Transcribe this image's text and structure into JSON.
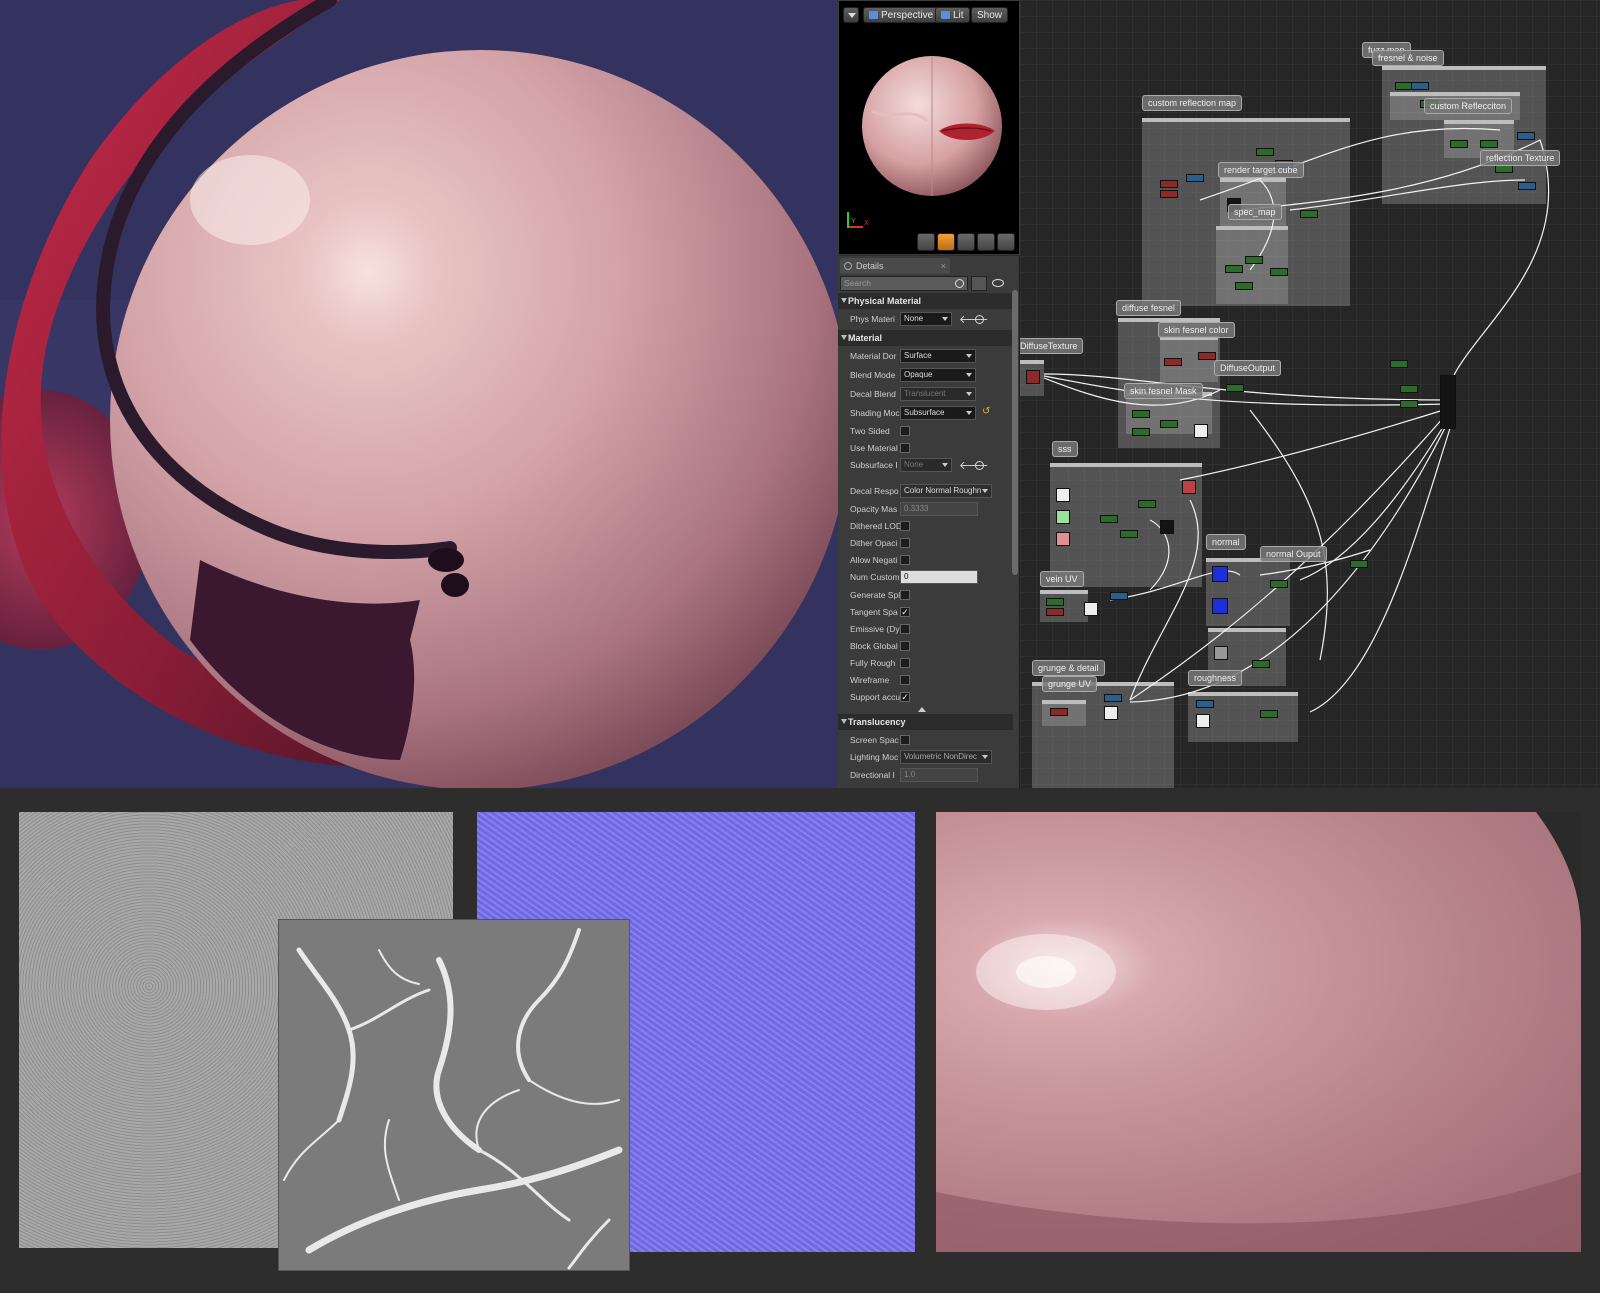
{
  "viewport": {
    "menu_label": "",
    "perspective_label": "Perspective",
    "lit_label": "Lit",
    "show_label": "Show",
    "axis_x": "X",
    "axis_y": "Y"
  },
  "details": {
    "tab_label": "Details",
    "tab_close": "×",
    "search_placeholder": "Search",
    "sections": {
      "physical_material": "Physical Material",
      "material": "Material",
      "translucency": "Translucency"
    },
    "properties": {
      "phys_material": {
        "label": "Phys Materi",
        "value": "None"
      },
      "material_domain": {
        "label": "Material Dor",
        "value": "Surface"
      },
      "blend_mode": {
        "label": "Blend Mode",
        "value": "Opaque"
      },
      "decal_blend": {
        "label": "Decal Blend",
        "value": "Translucent"
      },
      "shading_model": {
        "label": "Shading Moc",
        "value": "Subsurface"
      },
      "two_sided": {
        "label": "Two Sided",
        "checked": false
      },
      "use_material": {
        "label": "Use Material",
        "checked": false
      },
      "subsurface": {
        "label": "Subsurface I",
        "value": "None"
      },
      "decal_response": {
        "label": "Decal Respo",
        "value": "Color Normal Roughn"
      },
      "opacity_mask": {
        "label": "Opacity Mas",
        "value": "0.3333"
      },
      "dithered_lod": {
        "label": "Dithered LOD",
        "checked": false
      },
      "dither_opacity": {
        "label": "Dither Opaci",
        "checked": false
      },
      "allow_negative": {
        "label": "Allow Negati",
        "checked": false
      },
      "num_custom": {
        "label": "Num Custom",
        "value": "0"
      },
      "generate_spl": {
        "label": "Generate Spl",
        "checked": false
      },
      "tangent_space": {
        "label": "Tangent Spa",
        "checked": true
      },
      "emissive": {
        "label": "Emissive (Dy",
        "checked": false
      },
      "block_global": {
        "label": "Block Global",
        "checked": false
      },
      "fully_rough": {
        "label": "Fully Rough",
        "checked": false
      },
      "wireframe": {
        "label": "Wireframe",
        "checked": false
      },
      "support_accu": {
        "label": "Support accu",
        "checked": true
      },
      "screen_space": {
        "label": "Screen Spac",
        "checked": false
      },
      "lighting_mode": {
        "label": "Lighting Moc",
        "value": "Volumetric NonDirec"
      },
      "directional": {
        "label": "Directional I",
        "value": "1.0"
      }
    },
    "check_mark": "✓"
  },
  "graph": {
    "comments": {
      "fuzz_map": "fuzz map",
      "fresnel_noise": "fresnel & noise",
      "custom_reflection_map": "custom reflection map",
      "custom_reflection": "custom Reflecciton",
      "reflection_texture": "reflection Texture",
      "render_target_cube": "render target cube",
      "spec_map": "spec_map",
      "diffuse_fresnel": "diffuse  fesnel",
      "skin_fresnel_color": "skin fesnel color",
      "diffuse_texture": "DiffuseTexture",
      "diffuse_output": "DiffuseOutput",
      "skin_fresnel_mask": "skin fesnel Mask",
      "sss": "sss",
      "normal": "normal",
      "normal_output": "normal Ouput",
      "vein_uv": "vein UV",
      "grunge_detail": "grunge & detail",
      "grunge_uv": "grunge UV",
      "roughness": "roughness"
    }
  },
  "colors": {
    "hero_bg": "#34325f",
    "sphere": "#d9a9ad",
    "ribbon": "#b22840",
    "normal_map": "#7a73e6",
    "node_green": "#2d6b2d",
    "node_blue": "#2a5f8c",
    "checkbox_on": "#eeeeee"
  }
}
